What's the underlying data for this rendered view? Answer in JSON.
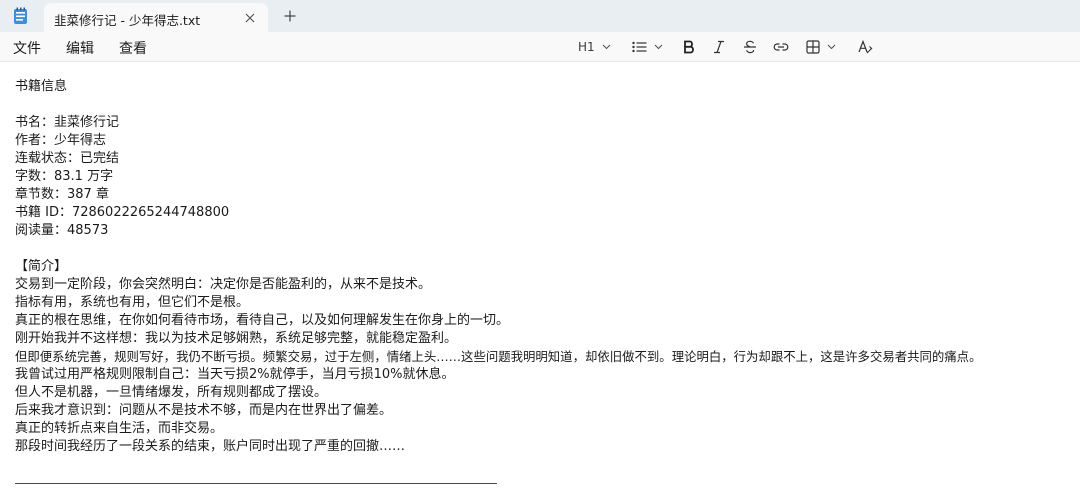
{
  "app": {
    "tab": {
      "title": "韭菜修行记 - 少年得志.txt"
    }
  },
  "menu": {
    "file": "文件",
    "edit": "编辑",
    "view": "查看"
  },
  "toolbar": {
    "heading": "H1"
  },
  "document": {
    "lines": [
      "书籍信息",
      "",
      "书名：韭菜修行记",
      "作者：少年得志",
      "连载状态：已完结",
      "字数：83.1 万字",
      "章节数：387 章",
      "书籍 ID：7286022265244748800",
      "阅读量：48573",
      "",
      "【简介】",
      "交易到一定阶段，你会突然明白：决定你是否能盈利的，从来不是技术。",
      "指标有用，系统也有用，但它们不是根。",
      "真正的根在思维，在你如何看待市场，看待自己，以及如何理解发生在你身上的一切。",
      "刚开始我并不这样想：我以为技术足够娴熟，系统足够完整，就能稳定盈利。",
      "但即便系统完善，规则写好，我仍不断亏损。频繁交易，过于左侧，情绪上头……这些问题我明明知道，却依旧做不到。理论明白，行为却跟不上，这是许多交易者共同的痛点。",
      "我曾试过用严格规则限制自己：当天亏损2%就停手，当月亏损10%就休息。",
      "但人不是机器，一旦情绪爆发，所有规则都成了摆设。",
      "后来我才意识到：问题从不是技术不够，而是内在世界出了偏差。",
      "真正的转折点来自生活，而非交易。",
      "那段时间我经历了一段关系的结束，账户同时出现了严重的回撤……"
    ]
  }
}
